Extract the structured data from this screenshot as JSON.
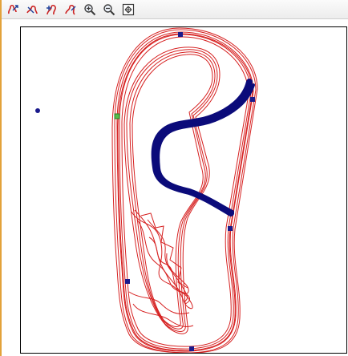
{
  "toolbar": {
    "buttons": [
      {
        "icon": "track-tool-1-icon"
      },
      {
        "icon": "track-tool-2-icon"
      },
      {
        "icon": "track-tool-3-icon"
      },
      {
        "icon": "track-tool-4-icon"
      },
      {
        "icon": "zoom-in-icon"
      },
      {
        "icon": "zoom-out-icon"
      },
      {
        "icon": "fit-view-icon"
      }
    ]
  },
  "colors": {
    "track_lines": "#d62020",
    "highlight_segment": "#0b0b7a",
    "marker": "#1a1a8c",
    "start_marker": "#55c04a",
    "frame": "#000000",
    "accent_bar": "#e3a23a"
  }
}
